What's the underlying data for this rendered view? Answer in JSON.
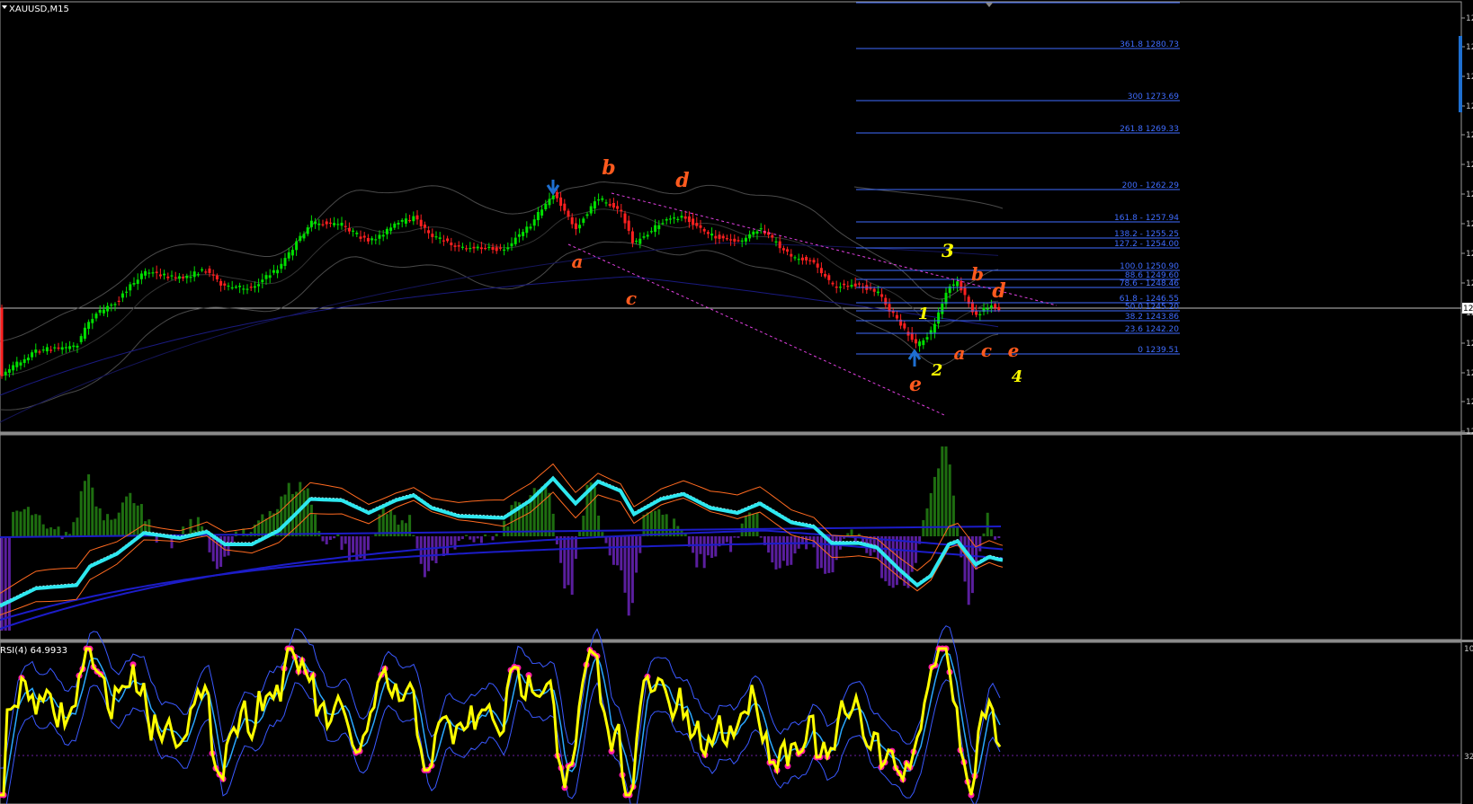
{
  "chart": {
    "symbol": "XAUUSD,M15",
    "rsi_label": "RSI(4) 64.9933",
    "rsi_axis_top": "10",
    "rsi_axis_level": "32",
    "price_axis_labels": [
      "12",
      "12",
      "12",
      "12",
      "12",
      "12",
      "12",
      "12",
      "12",
      "12",
      "12",
      "12",
      "12",
      "12",
      "12"
    ],
    "current_price_tag": "12"
  },
  "chart_data": [
    {
      "type": "candlestick",
      "title": "XAUUSD,M15",
      "fibonacci_levels": [
        {
          "label": "361.8 1280.73",
          "level": 361.8,
          "price": 1280.73
        },
        {
          "label": "300 1273.69",
          "level": 300,
          "price": 1273.69
        },
        {
          "label": "261.8 1269.33",
          "level": 261.8,
          "price": 1269.33
        },
        {
          "label": "200 - 1262.29",
          "level": 200,
          "price": 1262.29
        },
        {
          "label": "161.8 - 1257.94",
          "level": 161.8,
          "price": 1257.94
        },
        {
          "label": "138.2 - 1255.25",
          "level": 138.2,
          "price": 1255.25
        },
        {
          "label": "127.2 - 1254.00",
          "level": 127.2,
          "price": 1254.0
        },
        {
          "label": "100.0 1250.90",
          "level": 100.0,
          "price": 1250.9
        },
        {
          "label": "88.6 1249.60",
          "level": 88.6,
          "price": 1249.6
        },
        {
          "label": "78.6 - 1248.46",
          "level": 78.6,
          "price": 1248.46
        },
        {
          "label": "61.8 - 1246.55",
          "level": 61.8,
          "price": 1246.55
        },
        {
          "label": "50.0 1245.20",
          "level": 50.0,
          "price": 1245.2
        },
        {
          "label": "38.2 1243.86",
          "level": 38.2,
          "price": 1243.86
        },
        {
          "label": "23.6 1242.20",
          "level": 23.6,
          "price": 1242.2
        },
        {
          "label": "0 1239.51",
          "level": 0,
          "price": 1239.51
        }
      ],
      "wave_labels": [
        {
          "text": "b",
          "color": "#ff5a1e"
        },
        {
          "text": "d",
          "color": "#ff5a1e"
        },
        {
          "text": "a",
          "color": "#ff5a1e"
        },
        {
          "text": "c",
          "color": "#ff5a1e"
        },
        {
          "text": "3",
          "color": "#ffff00"
        },
        {
          "text": "b",
          "color": "#ff5a1e"
        },
        {
          "text": "d",
          "color": "#ff5a1e"
        },
        {
          "text": "1",
          "color": "#ffff00"
        },
        {
          "text": "a",
          "color": "#ff5a1e"
        },
        {
          "text": "c",
          "color": "#ff5a1e"
        },
        {
          "text": "e",
          "color": "#ff5a1e"
        },
        {
          "text": "2",
          "color": "#ffff00"
        },
        {
          "text": "e",
          "color": "#ff5a1e"
        },
        {
          "text": "4",
          "color": "#ffff00"
        }
      ],
      "colors": {
        "bull": "#00e000",
        "bear": "#ff2020",
        "fib": "#3f6cff",
        "trendline": "#e040e0"
      }
    },
    {
      "type": "histogram",
      "panel": "oscillator",
      "colors": {
        "positive": "#1e6e10",
        "negative": "#5a1e9e",
        "signal": "#2ee8f0",
        "bands": "#ff6a20",
        "envelope": "#1c1cc8"
      }
    },
    {
      "type": "line",
      "panel": "RSI",
      "title": "RSI(4) 64.9933",
      "current_value": 64.9933,
      "levels": [
        32
      ],
      "colors": {
        "rsi": "#ffff00",
        "dots": "#ff1aa8",
        "signal": "#2aa8ff",
        "bands": "#3a58ff"
      }
    }
  ]
}
